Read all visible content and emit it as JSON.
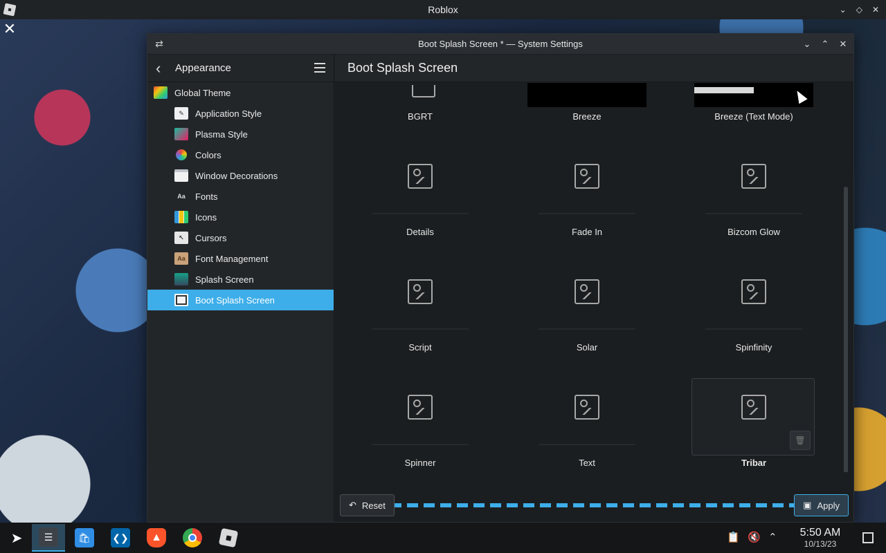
{
  "outer_window": {
    "title": "Roblox",
    "controls": [
      "chevron-down",
      "diamond",
      "close"
    ]
  },
  "window": {
    "title": "Boot Splash Screen * — System Settings"
  },
  "sidebar": {
    "section_title": "Appearance",
    "items": [
      {
        "label": "Global Theme",
        "icon": "global-theme-icon",
        "level": "top"
      },
      {
        "label": "Application Style",
        "icon": "application-style-icon",
        "level": "child"
      },
      {
        "label": "Plasma Style",
        "icon": "plasma-style-icon",
        "level": "child"
      },
      {
        "label": "Colors",
        "icon": "colors-icon",
        "level": "child"
      },
      {
        "label": "Window Decorations",
        "icon": "window-decorations-icon",
        "level": "child"
      },
      {
        "label": "Fonts",
        "icon": "fonts-icon",
        "level": "child"
      },
      {
        "label": "Icons",
        "icon": "icons-icon",
        "level": "child"
      },
      {
        "label": "Cursors",
        "icon": "cursors-icon",
        "level": "child"
      },
      {
        "label": "Font Management",
        "icon": "font-management-icon",
        "level": "child"
      },
      {
        "label": "Splash Screen",
        "icon": "splash-screen-icon",
        "level": "child"
      },
      {
        "label": "Boot Splash Screen",
        "icon": "boot-splash-icon",
        "level": "child",
        "active": true
      }
    ]
  },
  "main": {
    "page_title": "Boot Splash Screen",
    "themes": [
      {
        "label": "BGRT",
        "thumb": "partial"
      },
      {
        "label": "Breeze",
        "thumb": "black"
      },
      {
        "label": "Breeze (Text Mode)",
        "thumb": "black-bar"
      },
      {
        "label": "Details",
        "thumb": "placeholder"
      },
      {
        "label": "Fade In",
        "thumb": "placeholder"
      },
      {
        "label": "Bizcom Glow",
        "thumb": "placeholder"
      },
      {
        "label": "Script",
        "thumb": "placeholder"
      },
      {
        "label": "Solar",
        "thumb": "placeholder"
      },
      {
        "label": "Spinfinity",
        "thumb": "placeholder"
      },
      {
        "label": "Spinner",
        "thumb": "placeholder"
      },
      {
        "label": "Text",
        "thumb": "placeholder"
      },
      {
        "label": "Tribar",
        "thumb": "placeholder",
        "selected": true
      }
    ],
    "reset_label": "Reset",
    "apply_label": "Apply"
  },
  "taskbar": {
    "apps": [
      "app-launcher-icon",
      "system-settings-icon",
      "discover-icon",
      "vscode-icon",
      "brave-icon",
      "chrome-icon",
      "roblox-icon"
    ],
    "time": "5:50 AM",
    "date": "10/13/23"
  },
  "colors": {
    "accent": "#3daee9",
    "window_bg": "#1f2226",
    "sidebar_bg": "#232629"
  }
}
